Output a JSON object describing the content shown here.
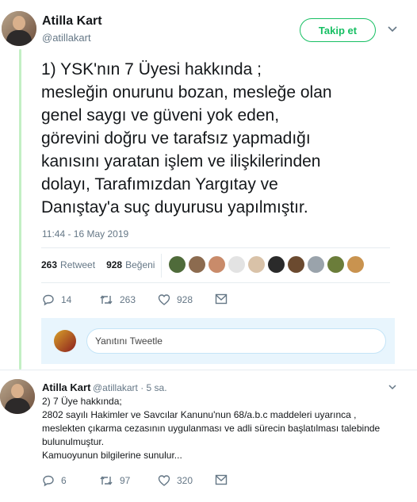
{
  "tweet": {
    "author_name": "Atilla Kart",
    "author_handle": "@atillakart",
    "follow_label": "Takip et",
    "text_lines": [
      "1) YSK'nın 7 Üyesi hakkında ;",
      "mesleğin onurunu bozan, mesleğe olan",
      "genel saygı ve güveni yok eden,",
      "görevini doğru ve tarafsız yapmadığı",
      "kanısını yaratan işlem ve ilişkilerinden",
      "dolayı, Tarafımızdan Yargıtay ve",
      "Danıştay'a suç duyurusu yapılmıştır."
    ],
    "timestamp": "11:44 - 16 May 2019",
    "retweet_count": "263",
    "retweet_label": "Retweet",
    "like_count": "928",
    "like_label": "Beğeni",
    "actions": {
      "reply": "14",
      "retweet": "263",
      "like": "928"
    },
    "liker_colors": [
      "#4f6b3a",
      "#8c6b4f",
      "#c98b6a",
      "#e3e3e3",
      "#d9c2a8",
      "#2a2a2a",
      "#6b4a2f",
      "#9aa3ab",
      "#6b7d3a",
      "#c9934f"
    ]
  },
  "reply_box": {
    "placeholder": "Yanıtını Tweetle"
  },
  "reply_tweet": {
    "author_name": "Atilla Kart",
    "meta": "@atillakart · 5 sa.",
    "text_lines": [
      "2) 7 Üye hakkında;",
      "2802 sayılı Hakimler ve Savcılar Kanunu'nun 68/a.b.c maddeleri uyarınca ,",
      "meslekten çıkarma cezasının uygulanması ve adli sürecin başlatılması talebinde",
      "bulunulmuştur.",
      "Kamuoyunun bilgilerine sunulur..."
    ],
    "actions": {
      "reply": "6",
      "retweet": "97",
      "like": "320"
    }
  },
  "colors": {
    "accent": "#17bf63",
    "thread_line": "#c3efc4",
    "muted": "#657786"
  }
}
